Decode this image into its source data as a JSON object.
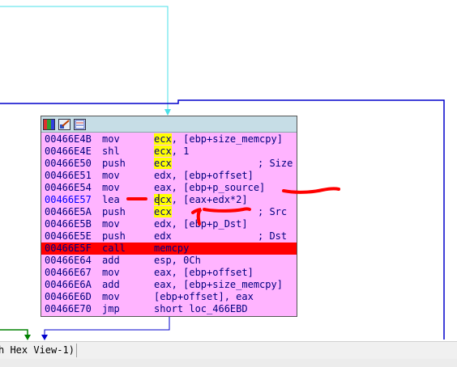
{
  "node": {
    "toolbar": [
      {
        "icon": "palette-icon"
      },
      {
        "icon": "edit-graph-icon"
      },
      {
        "icon": "zoom-graph-icon"
      }
    ],
    "lines": [
      {
        "addr": "00466E4B",
        "mnemonic": "mov",
        "operand_hl": "ecx",
        "operand_rest": ", [ebp+size_memcpy]",
        "comment": ""
      },
      {
        "addr": "00466E4E",
        "mnemonic": "shl",
        "operand_hl": "ecx",
        "operand_rest": ", 1",
        "comment": ""
      },
      {
        "addr": "00466E50",
        "mnemonic": "push",
        "operand_hl": "ecx",
        "operand_rest": "",
        "comment": "; Size"
      },
      {
        "addr": "00466E51",
        "mnemonic": "mov",
        "operand_hl": "",
        "operand_rest": "edx, [ebp+offset]",
        "comment": ""
      },
      {
        "addr": "00466E54",
        "mnemonic": "mov",
        "operand_hl": "",
        "operand_rest": "eax, [ebp+p_source]",
        "comment": ""
      },
      {
        "addr": "00466E57",
        "mnemonic": "lea",
        "operand_hl": "ecx",
        "operand_rest": ", [eax+edx*2]",
        "comment": ""
      },
      {
        "addr": "00466E5A",
        "mnemonic": "push",
        "operand_hl": "ecx",
        "operand_rest": "",
        "comment": "; Src"
      },
      {
        "addr": "00466E5B",
        "mnemonic": "mov",
        "operand_hl": "",
        "operand_rest": "edx, [ebp+p_Dst]",
        "comment": ""
      },
      {
        "addr": "00466E5E",
        "mnemonic": "push",
        "operand_hl": "",
        "operand_rest": "edx",
        "comment": "; Dst"
      },
      {
        "addr": "00466E5F",
        "mnemonic": "call",
        "operand_hl": "",
        "operand_rest": "memcpy",
        "comment": ""
      },
      {
        "addr": "00466E64",
        "mnemonic": "add",
        "operand_hl": "",
        "operand_rest": "esp, 0Ch",
        "comment": ""
      },
      {
        "addr": "00466E67",
        "mnemonic": "mov",
        "operand_hl": "",
        "operand_rest": "eax, [ebp+offset]",
        "comment": ""
      },
      {
        "addr": "00466E6A",
        "mnemonic": "add",
        "operand_hl": "",
        "operand_rest": "eax, [ebp+size_memcpy]",
        "comment": ""
      },
      {
        "addr": "00466E6D",
        "mnemonic": "mov",
        "operand_hl": "",
        "operand_rest": "[ebp+offset], eax",
        "comment": ""
      },
      {
        "addr": "00466E70",
        "mnemonic": "jmp",
        "operand_hl": "",
        "operand_rest": "short loc_466EBD",
        "comment": ""
      }
    ]
  },
  "statusbar": {
    "tab_label": "h Hex View-1)"
  },
  "colors": {
    "node_bg": "#ffb4ff",
    "highlight": "#ffff00",
    "call_line": "#ff0000",
    "edge_cyan": "#4ae0e8",
    "edge_blue": "#0000cc",
    "edge_green": "#008000",
    "annotation_red": "#ff0000"
  }
}
